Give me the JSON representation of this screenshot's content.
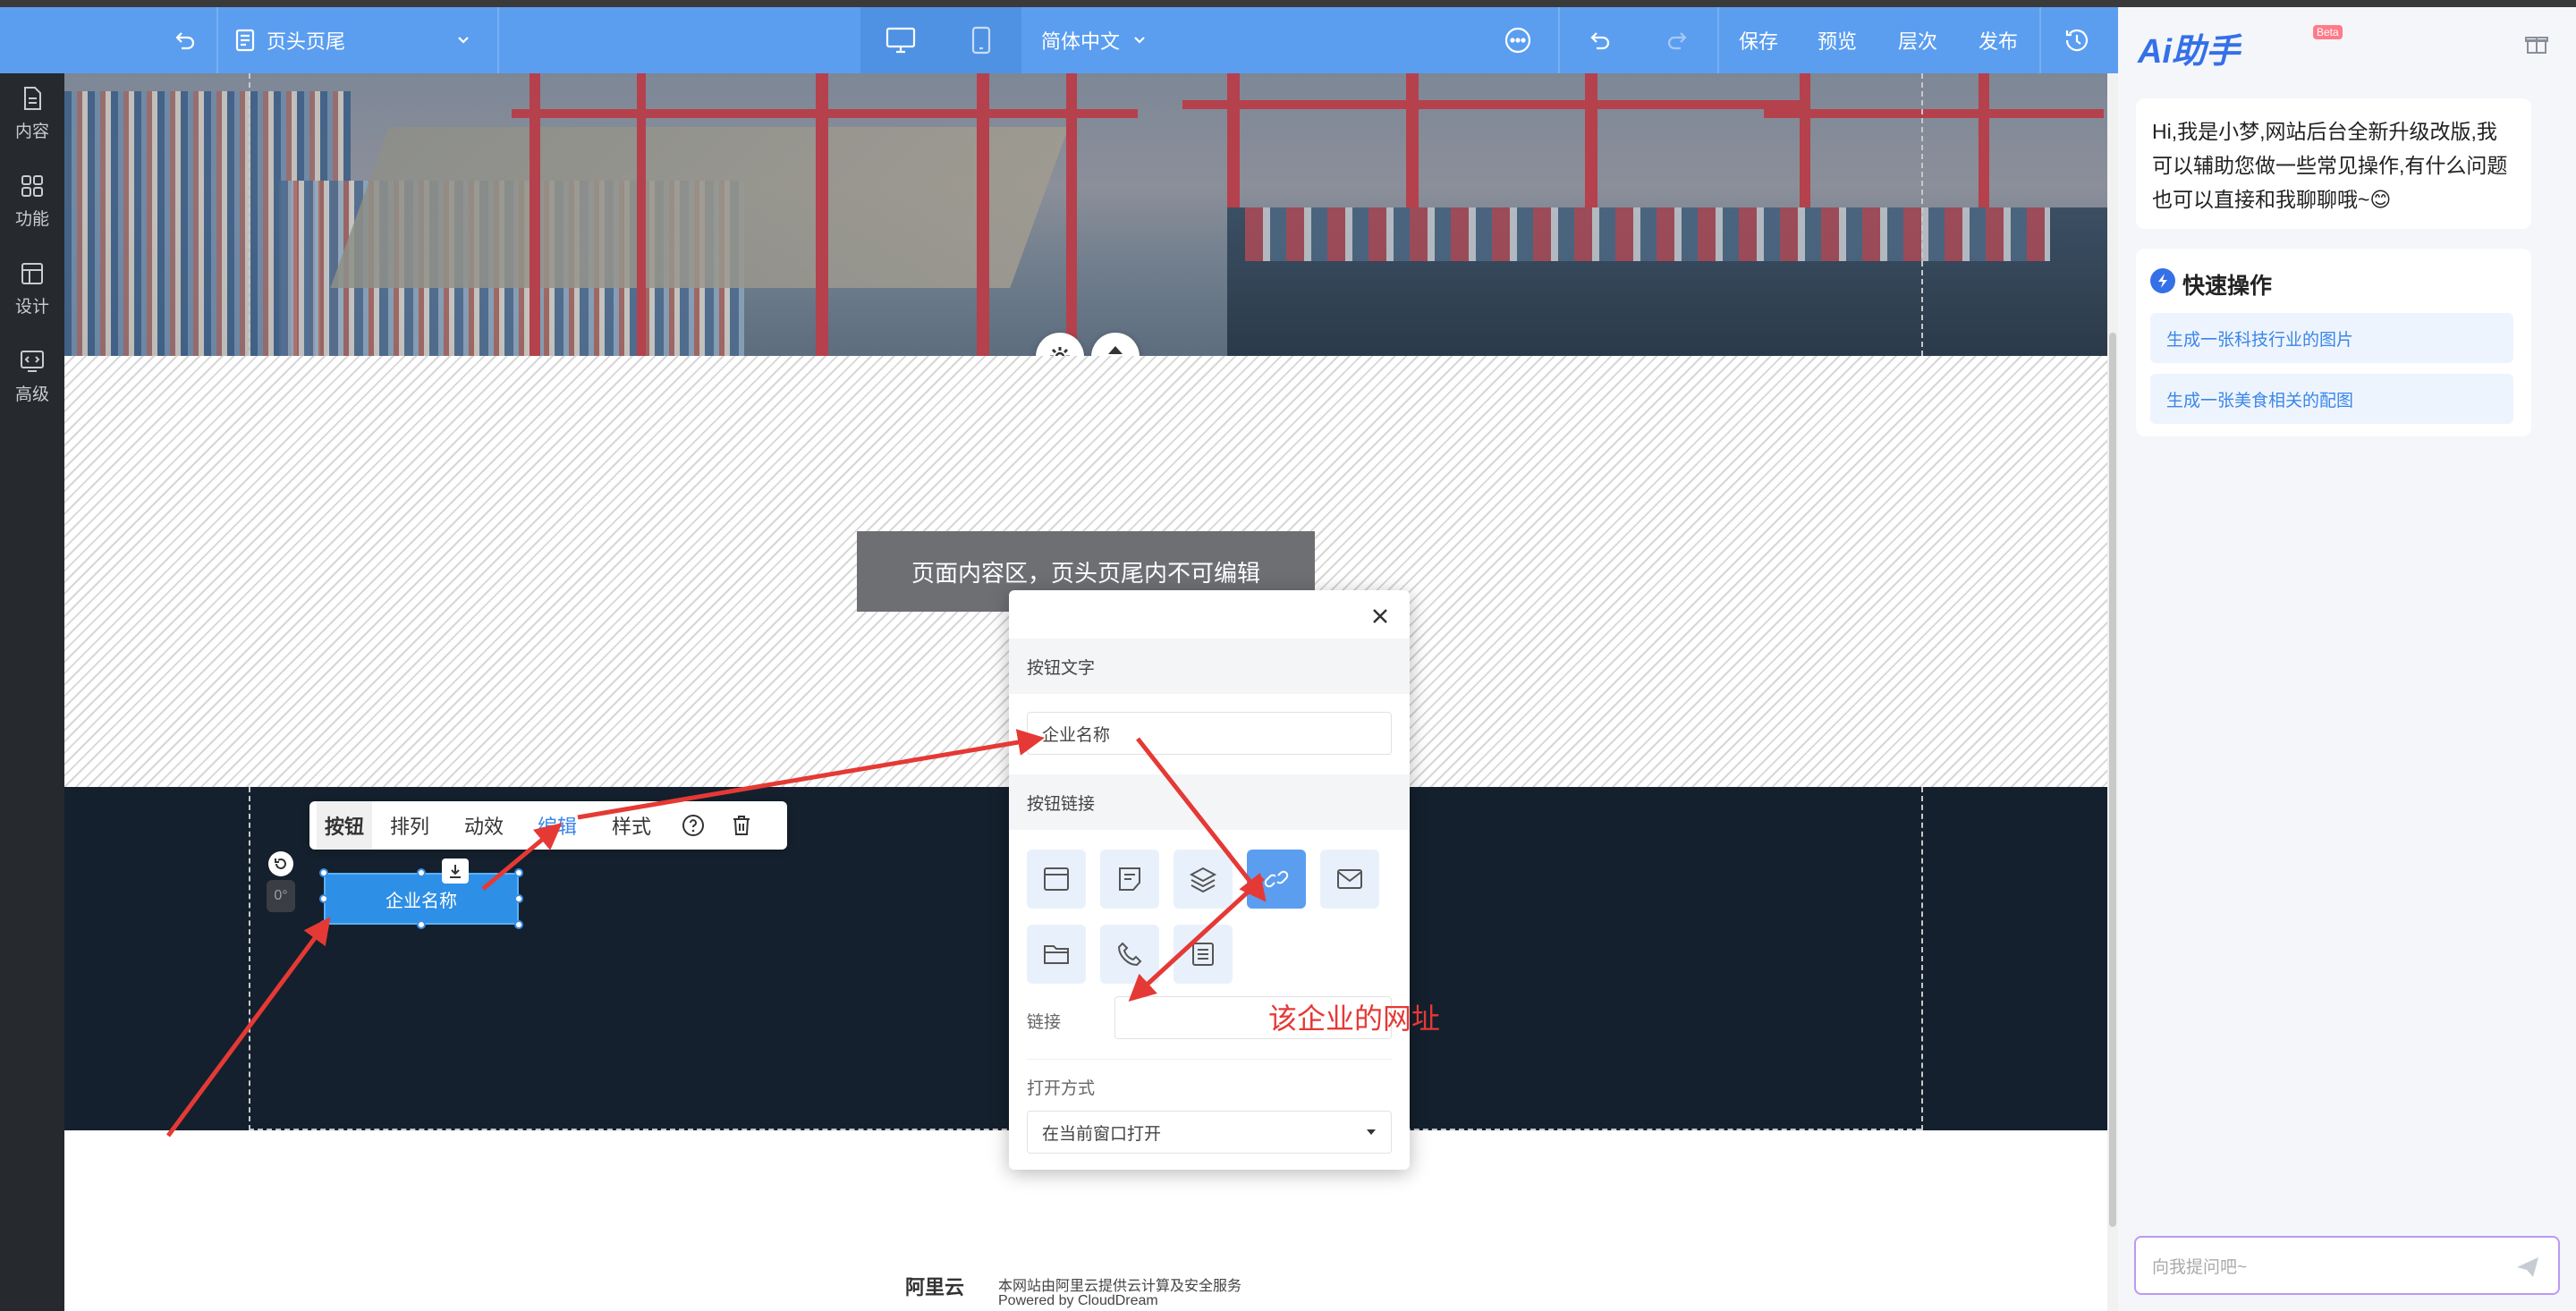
{
  "topbar": {
    "page_selector": "页头页尾",
    "language": "简体中文",
    "save": "保存",
    "preview": "预览",
    "layers": "层次",
    "publish": "发布"
  },
  "sidebar": {
    "items": [
      {
        "label": "内容",
        "icon": "document-icon"
      },
      {
        "label": "功能",
        "icon": "grid-icon"
      },
      {
        "label": "设计",
        "icon": "layout-icon"
      },
      {
        "label": "高级",
        "icon": "code-icon"
      }
    ]
  },
  "canvas": {
    "notice": "页面内容区，页头页尾内不可编辑",
    "company_button": "企业名称",
    "rotation": "0°"
  },
  "mini_toolbar": {
    "tabs": [
      "按钮",
      "排列",
      "动效",
      "编辑",
      "样式"
    ]
  },
  "popup": {
    "button_text_header": "按钮文字",
    "button_text_value": "企业名称",
    "button_link_header": "按钮链接",
    "link_label": "链接",
    "link_value": "",
    "open_mode_label": "打开方式",
    "open_mode_value": "在当前窗口打开"
  },
  "annotation": "该企业的网址",
  "powered": {
    "logo": "阿里云",
    "line1": "本网站由阿里云提供云计算及安全服务",
    "line2": "Powered by CloudDream"
  },
  "ai_panel": {
    "title": "Ai助手",
    "badge": "Beta",
    "greeting": "Hi,我是小梦,网站后台全新升级改版,我可以辅助您做一些常见操作,有什么问题也可以直接和我聊聊哦~😊",
    "quick_title": "快速操作",
    "quick_items": [
      "生成一张科技行业的图片",
      "生成一张美食相关的配图"
    ],
    "input_placeholder": "向我提问吧~"
  },
  "colors": {
    "topbar": "#5b9ef0",
    "accent": "#3a86e8",
    "annotation": "#e53935",
    "footer": "#14202d"
  }
}
